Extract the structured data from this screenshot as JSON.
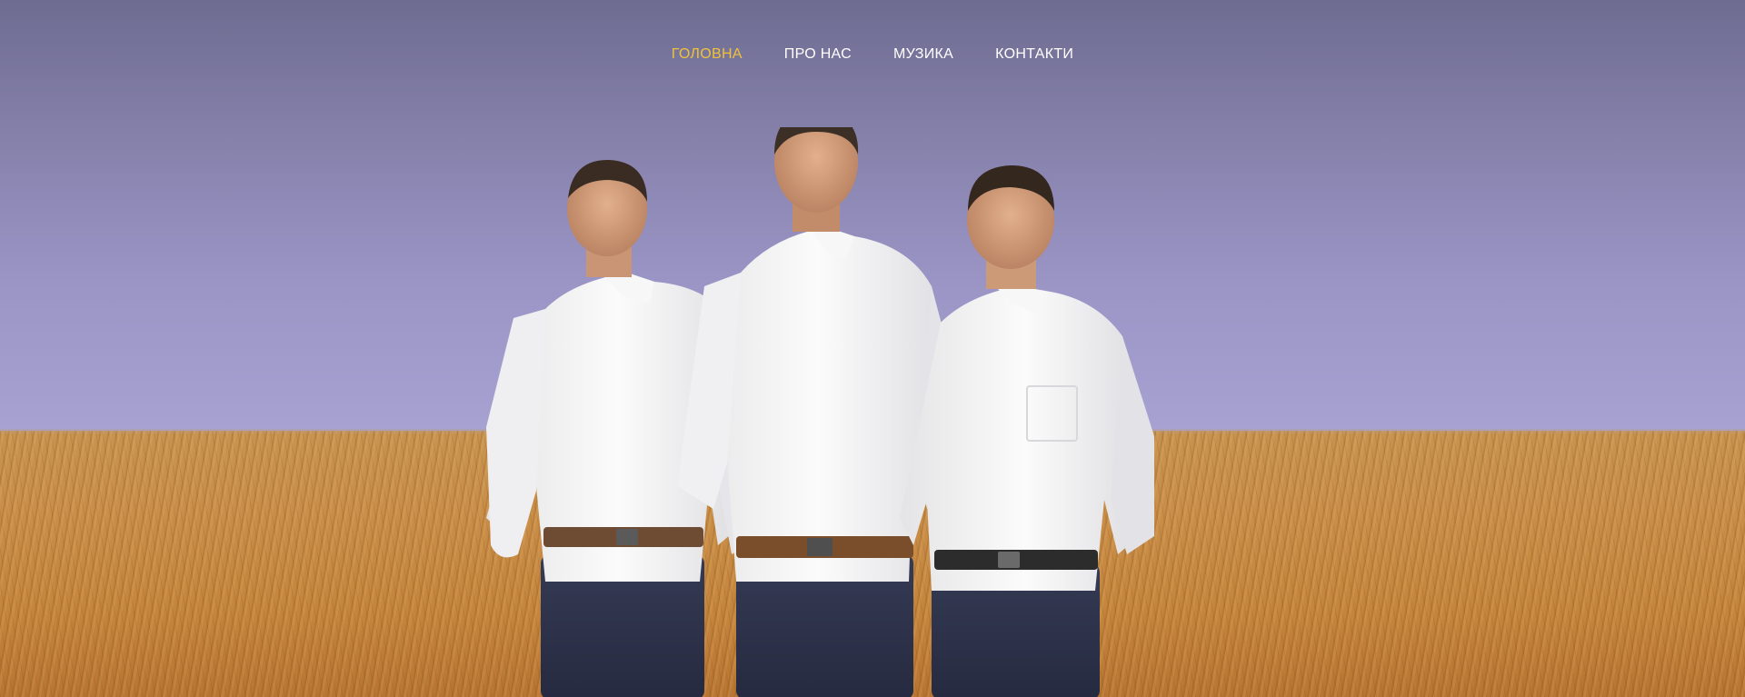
{
  "nav": {
    "items": [
      {
        "label": "ГОЛОВНА",
        "active": true
      },
      {
        "label": "ПРО НАС",
        "active": false
      },
      {
        "label": "МУЗИКА",
        "active": false
      },
      {
        "label": "КОНТАКТИ",
        "active": false
      }
    ],
    "text_color": "#ffffff",
    "active_color": "#f0c23a"
  },
  "hero": {
    "sky_color": "#a7a2d2",
    "field_color": "#c98d47",
    "image_subject": "three-men-in-white-shirts-in-wheat-field"
  }
}
